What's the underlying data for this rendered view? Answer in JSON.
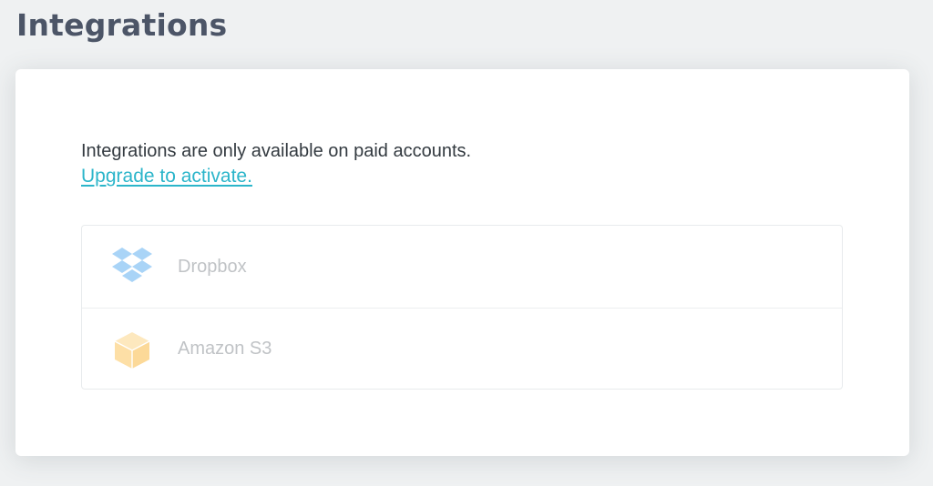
{
  "page": {
    "title": "Integrations"
  },
  "notice": {
    "message": "Integrations are only available on paid accounts.",
    "upgrade_link": "Upgrade to activate."
  },
  "integrations": [
    {
      "label": "Dropbox",
      "icon": "dropbox-icon"
    },
    {
      "label": "Amazon S3",
      "icon": "amazon-s3-box-icon"
    }
  ],
  "colors": {
    "background": "#eff1f2",
    "title": "#4c5567",
    "link": "#2bb5ca",
    "dropbox_icon": "#a9d4f7",
    "s3_icon": "#fde1ad",
    "disabled_text": "#c0c3c6"
  }
}
